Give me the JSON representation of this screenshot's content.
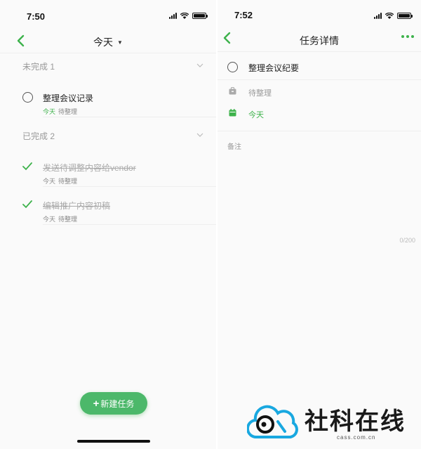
{
  "left": {
    "status_time": "7:50",
    "nav_title": "今天",
    "sections": [
      {
        "label": "未完成 1",
        "tasks": [
          {
            "title": "整理会议记录",
            "date": "今天",
            "list": "待整理",
            "done": false
          }
        ]
      },
      {
        "label": "已完成 2",
        "tasks": [
          {
            "title": "发送待调整内容给vendor",
            "date": "今天",
            "list": "待整理",
            "done": true
          },
          {
            "title": "编辑推广内容初稿",
            "date": "今天",
            "list": "待整理",
            "done": true
          }
        ]
      }
    ],
    "add_button_label": "新建任务"
  },
  "right": {
    "status_time": "7:52",
    "nav_title": "任务详情",
    "task_title": "整理会议纪要",
    "list_name": "待整理",
    "due": "今天",
    "notes_label": "备注",
    "char_count": "0/200"
  },
  "watermark": {
    "name": "社科在线",
    "url": "cass.com.cn"
  },
  "colors": {
    "accent": "#3db24b",
    "button": "#4cb86a",
    "muted": "#999999"
  }
}
